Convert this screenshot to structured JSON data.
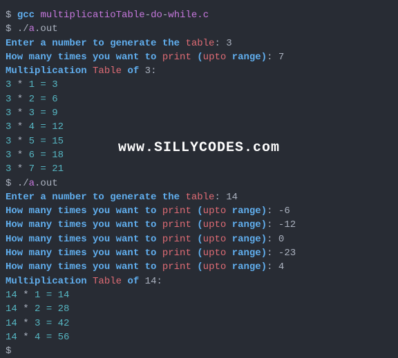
{
  "prompt": "$ ",
  "promptOnly": "$",
  "gcc": "gcc",
  "file1": "multiplicatioTable",
  "dash": "-",
  "file2": "do",
  "file3": "while.c",
  "runDot": "./",
  "runA": "a",
  "runOut": ".out",
  "enterPrompt": "Enter a number to generate the ",
  "tableWord": "table",
  "colon": ": ",
  "howMany": "How many times you want to ",
  "printWord": "print",
  "space": " ",
  "openParen": "(",
  "uptoWord": "upto",
  "rangeWord": " range",
  "closeParen": ")",
  "multWord": "Multiplication",
  "tableOfTab": " Table",
  "ofWord": " of",
  "run1": {
    "num": "3",
    "range": "7",
    "rows": [
      {
        "a": "3",
        "b": "1",
        "r": "3"
      },
      {
        "a": "3",
        "b": "2",
        "r": "6"
      },
      {
        "a": "3",
        "b": "3",
        "r": "9"
      },
      {
        "a": "3",
        "b": "4",
        "r": "12"
      },
      {
        "a": "3",
        "b": "5",
        "r": "15"
      },
      {
        "a": "3",
        "b": "6",
        "r": "18"
      },
      {
        "a": "3",
        "b": "7",
        "r": "21"
      }
    ]
  },
  "run2": {
    "num": "14",
    "attempts": [
      "-6",
      "-12",
      "0",
      "-23",
      "4"
    ],
    "rows": [
      {
        "a": "14",
        "b": "1",
        "r": "14"
      },
      {
        "a": "14",
        "b": "2",
        "r": "28"
      },
      {
        "a": "14",
        "b": "3",
        "r": "42"
      },
      {
        "a": "14",
        "b": "4",
        "r": "56"
      }
    ]
  },
  "star": " * ",
  "equals": " = ",
  "watermark": {
    "www": "www.",
    "name": "SILLYCODES",
    "com": ".com"
  }
}
